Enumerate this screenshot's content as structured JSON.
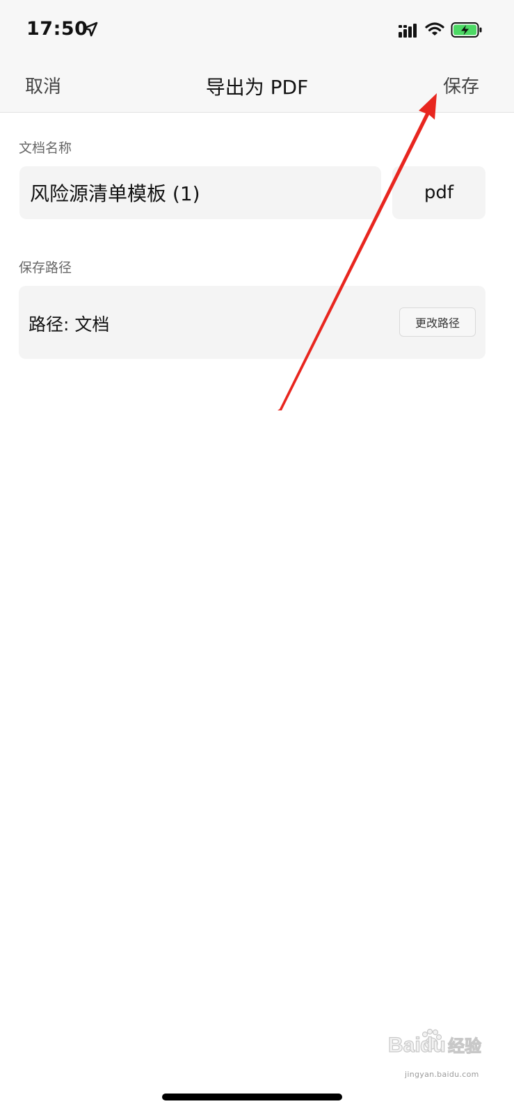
{
  "status_bar": {
    "time": "17:50",
    "location_icon": "location-arrow-icon",
    "signal_icon": "cellular-signal-icon",
    "wifi_icon": "wifi-icon",
    "battery_icon": "battery-charging-icon",
    "battery_color": "#4cd964"
  },
  "nav": {
    "cancel_label": "取消",
    "title": "导出为 PDF",
    "save_label": "保存"
  },
  "document_name": {
    "label": "文档名称",
    "value": "风险源清单模板 (1)",
    "extension": "pdf"
  },
  "save_path": {
    "label": "保存路径",
    "path_text": "路径: 文档",
    "change_button_label": "更改路径"
  },
  "annotation": {
    "arrow_color": "#e8261f",
    "arrow_target": "save-button"
  },
  "watermark": {
    "logo_text": "Baidu",
    "logo_suffix": "经验",
    "url": "jingyan.baidu.com"
  }
}
